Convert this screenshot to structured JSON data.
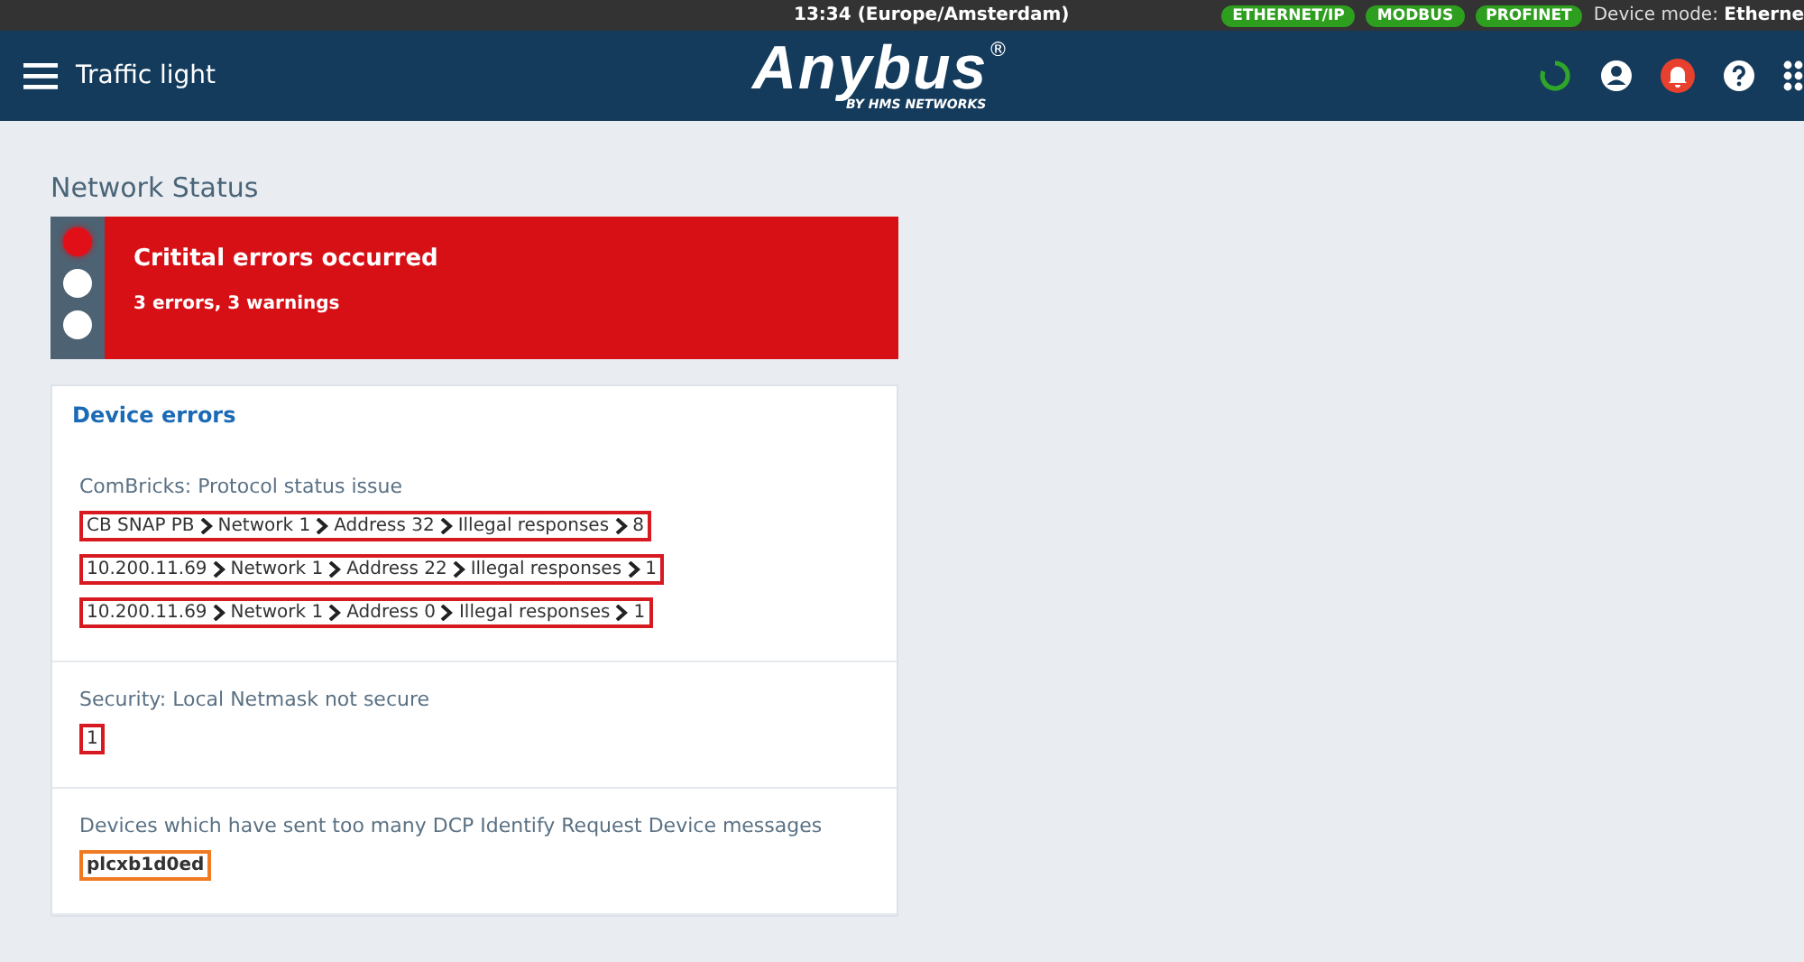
{
  "top_bar": {
    "time": "13:34 (Europe/Amsterdam)",
    "protocols": [
      "ETHERNET/IP",
      "MODBUS",
      "PROFINET"
    ],
    "device_mode": "Device mode: **Etherne**"
  },
  "header": {
    "title": "Traffic light",
    "logo": "Anybus",
    "logo_mark": "®",
    "logo_tagline": "BY HMS NETWORKS"
  },
  "page_title": "Network Status",
  "status": {
    "lights": [
      {
        "on": true
      },
      {
        "on": false
      },
      {
        "on": false
      }
    ],
    "title": "Critital errors occurred",
    "summary": "3 errors, 3 warnings"
  },
  "card": {
    "title": "Device errors",
    "sections": [
      {
        "title": "ComBricks: Protocol status issue",
        "tags": [
          {
            "kind": "error",
            "color": "#d71920",
            "parts": [
              "CB SNAP PB",
              "Network 1",
              "Address 32",
              "Illegal responses",
              "8"
            ]
          },
          {
            "kind": "error",
            "color": "#d71920",
            "parts": [
              "10.200.11.69",
              "Network 1",
              "Address 22",
              "Illegal responses",
              "1"
            ]
          },
          {
            "kind": "error",
            "color": "#d71920",
            "parts": [
              "10.200.11.69",
              "Network 1",
              "Address 0",
              "Illegal responses",
              "1"
            ]
          }
        ]
      },
      {
        "title": "Security: Local Netmask not secure",
        "tags": [
          {
            "kind": "error",
            "color": "#d71920",
            "parts": [
              "1"
            ]
          }
        ]
      },
      {
        "title": "Devices which have sent too many DCP Identify Request Device messages",
        "tags": [
          {
            "kind": "warning",
            "color": "#f07a22",
            "parts": [
              "plcxb1d0ed"
            ]
          }
        ]
      }
    ]
  }
}
